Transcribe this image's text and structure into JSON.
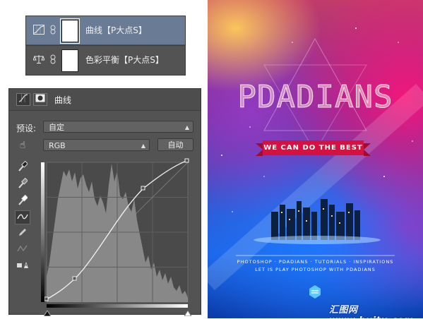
{
  "layers": [
    {
      "name": "曲线【P大点S】",
      "icon": "curves-adjustment-icon",
      "selected": true
    },
    {
      "name": "色彩平衡【P大点S】",
      "icon": "color-balance-icon",
      "selected": false
    }
  ],
  "properties": {
    "title": "曲线",
    "preset_label": "预设:",
    "preset_value": "自定",
    "channel_value": "RGB",
    "auto_button": "自动",
    "tools": [
      "sample-in-image-set-black-point-icon",
      "sample-in-image-set-gray-point-icon",
      "sample-in-image-set-white-point-icon",
      "edit-points-curve-icon",
      "draw-curve-pencil-icon",
      "smooth-curve-icon",
      "clipping-warning-icon"
    ]
  },
  "poster": {
    "title": "PDADIANS",
    "ribbon": "WE CAN DO THE BEST",
    "line1": "PHOTOSHOP · PDADIANS · TUTORIALS · INSPIRATIONS",
    "line2": "LET IS PLAY PHOTOSHOP WITH PDADIANS",
    "watermark": "汇图网 www.huitu.com"
  },
  "colors": {
    "panel_bg": "#535353",
    "selected_layer": "#6a7b95",
    "ribbon_red": "#d4123f"
  }
}
